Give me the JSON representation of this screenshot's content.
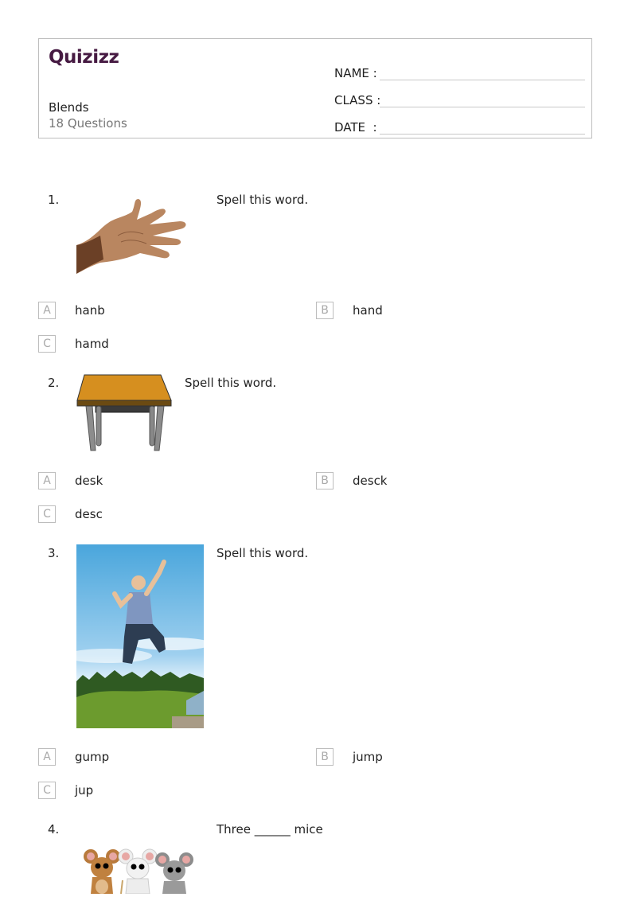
{
  "header": {
    "logo": "Quizizz",
    "title": "Blends",
    "question_count": "18 Questions",
    "fields": [
      {
        "label": "NAME :"
      },
      {
        "label": "CLASS :"
      },
      {
        "label": "DATE  :"
      }
    ]
  },
  "questions": [
    {
      "number": "1.",
      "text": "Spell this word.",
      "image": "hand-image",
      "options": [
        {
          "letter": "A",
          "text": "hanb"
        },
        {
          "letter": "B",
          "text": "hand"
        },
        {
          "letter": "C",
          "text": "hamd"
        }
      ]
    },
    {
      "number": "2.",
      "text": "Spell this word.",
      "image": "desk-image",
      "options": [
        {
          "letter": "A",
          "text": "desk"
        },
        {
          "letter": "B",
          "text": "desck"
        },
        {
          "letter": "C",
          "text": "desc"
        }
      ]
    },
    {
      "number": "3.",
      "text": "Spell this word.",
      "image": "jumping-boy-image",
      "options": [
        {
          "letter": "A",
          "text": "gump"
        },
        {
          "letter": "B",
          "text": "jump"
        },
        {
          "letter": "C",
          "text": "jup"
        }
      ]
    },
    {
      "number": "4.",
      "text": "Three ______ mice",
      "image": "three-mice-image",
      "options": []
    }
  ]
}
